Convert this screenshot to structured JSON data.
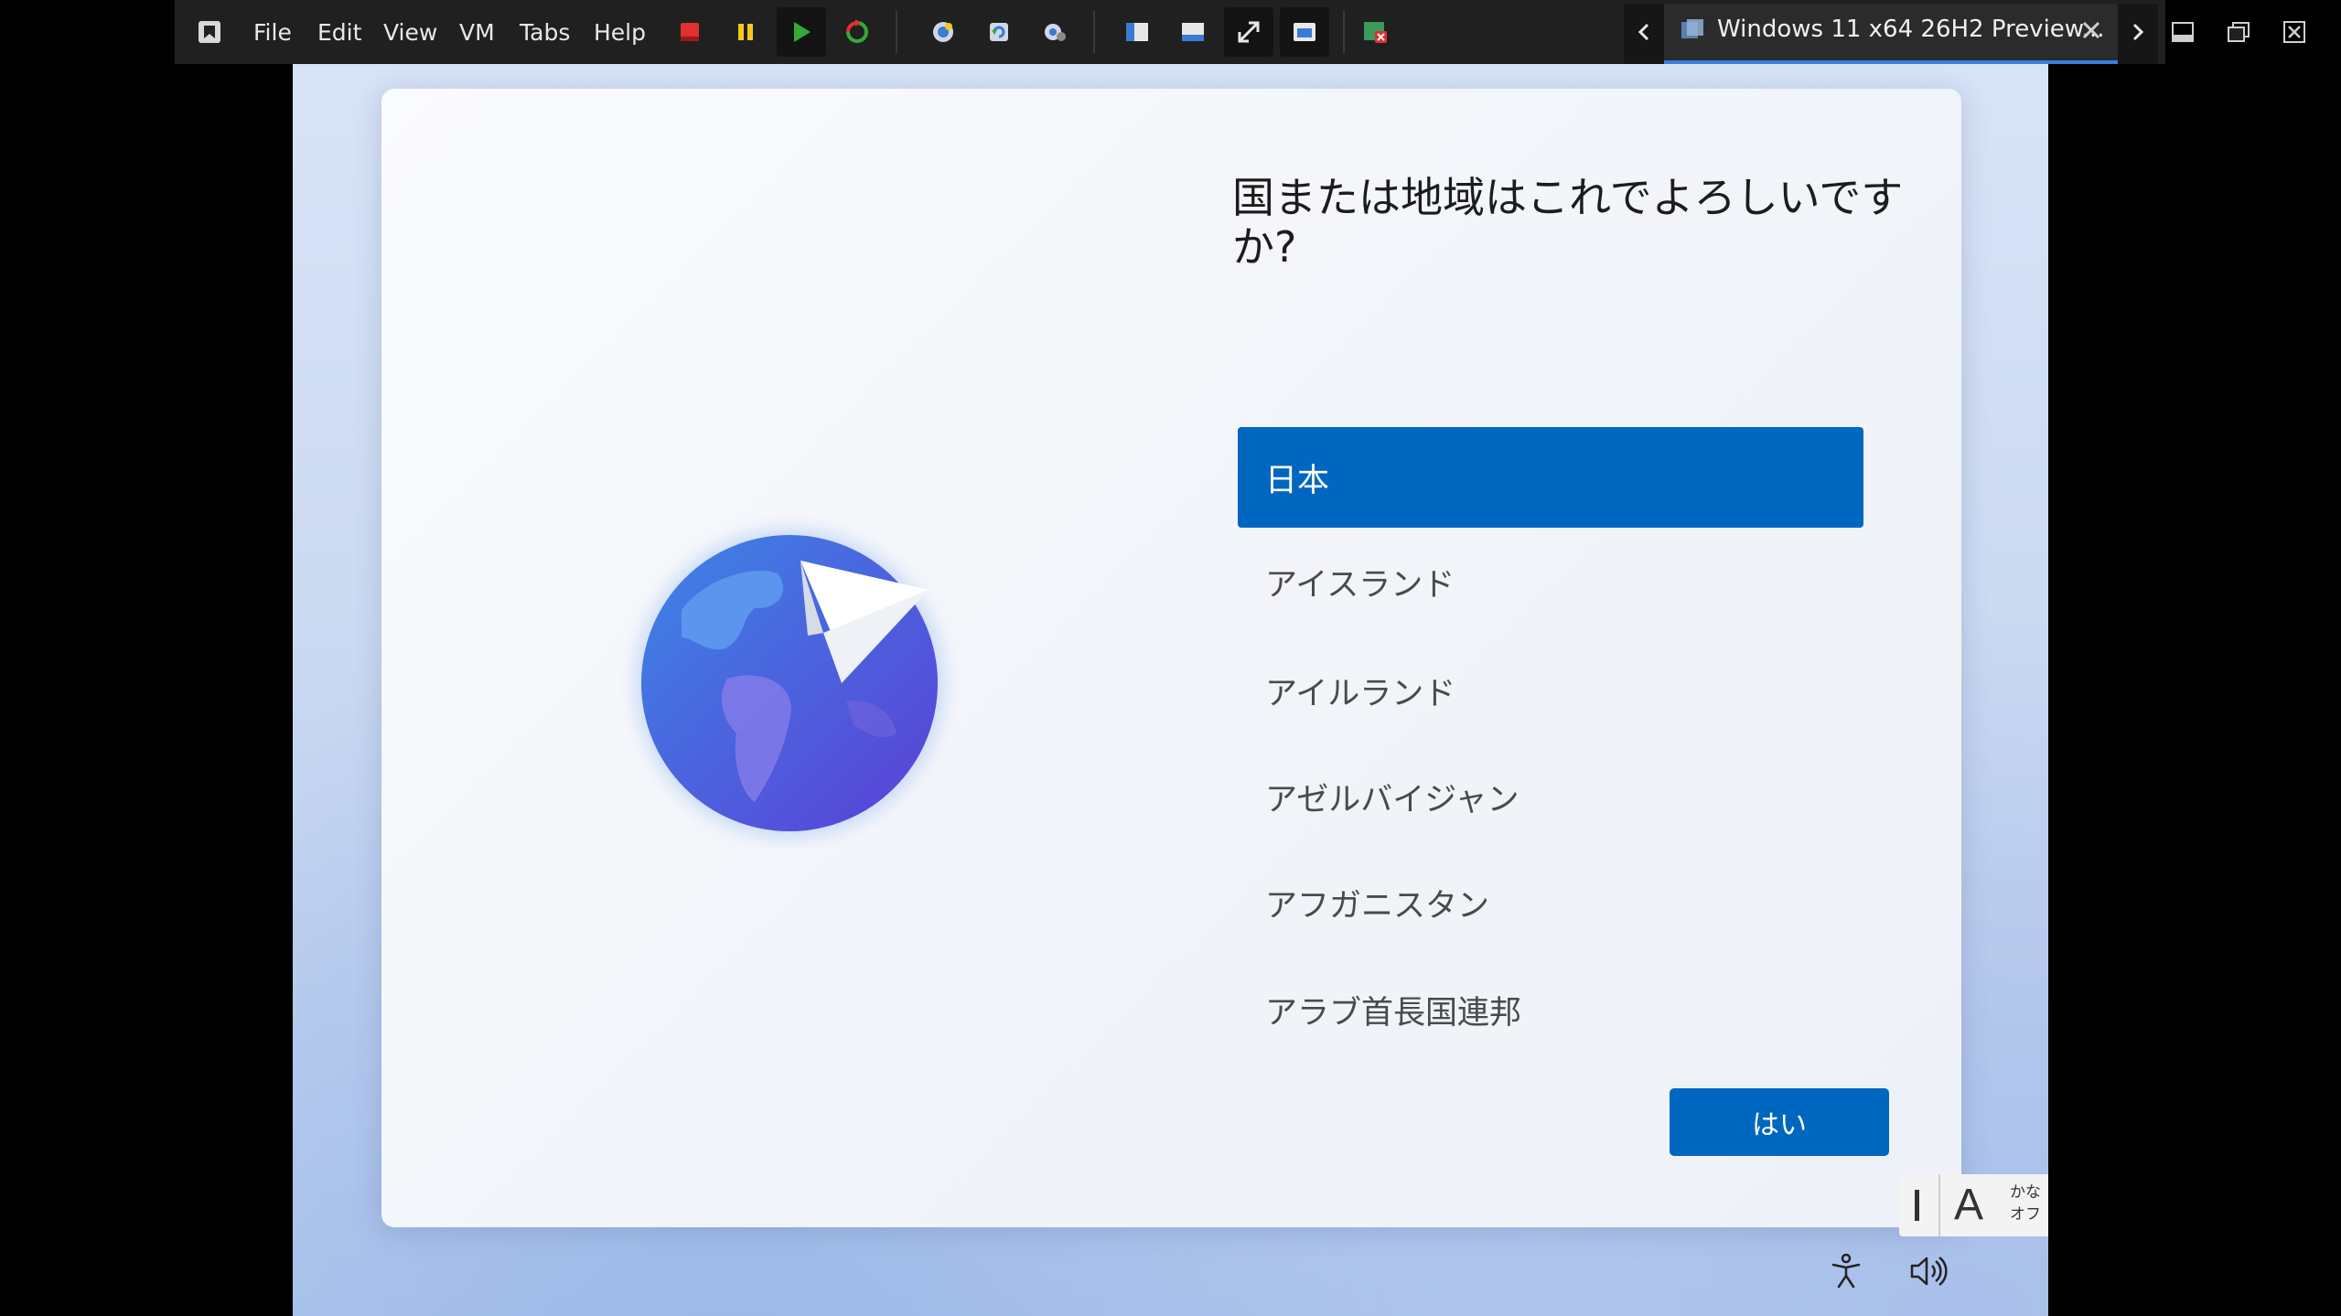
{
  "toolbar": {
    "menu": [
      "File",
      "Edit",
      "View",
      "VM",
      "Tabs",
      "Help"
    ],
    "tab": {
      "title": "Windows 11 x64 26H2 Preview..."
    },
    "colors": {
      "stop": "#e03030",
      "pause": "#f2c81a",
      "play": "#38a838",
      "tab_underline": "#3b7ce0"
    }
  },
  "setup": {
    "question": "国または地域はこれでよろしいですか?",
    "countries": [
      "日本",
      "アイスランド",
      "アイルランド",
      "アゼルバイジャン",
      "アフガニスタン",
      "アラブ首長国連邦"
    ],
    "selected_index": 0,
    "yes_button": "はい",
    "accent": "#0067c0"
  },
  "ime": {
    "mode": "A",
    "kana_line1": "かな",
    "kana_line2": "オフ"
  },
  "icons": [
    "vmware-logo-icon",
    "power-off-icon",
    "suspend-icon",
    "power-on-icon",
    "reset-icon",
    "snapshot-icon",
    "revert-snapshot-icon",
    "manage-snapshots-icon",
    "library-icon",
    "console-view-icon",
    "fullscreen-icon",
    "unity-icon",
    "close-tab-icon",
    "accessibility-icon",
    "volume-icon"
  ]
}
